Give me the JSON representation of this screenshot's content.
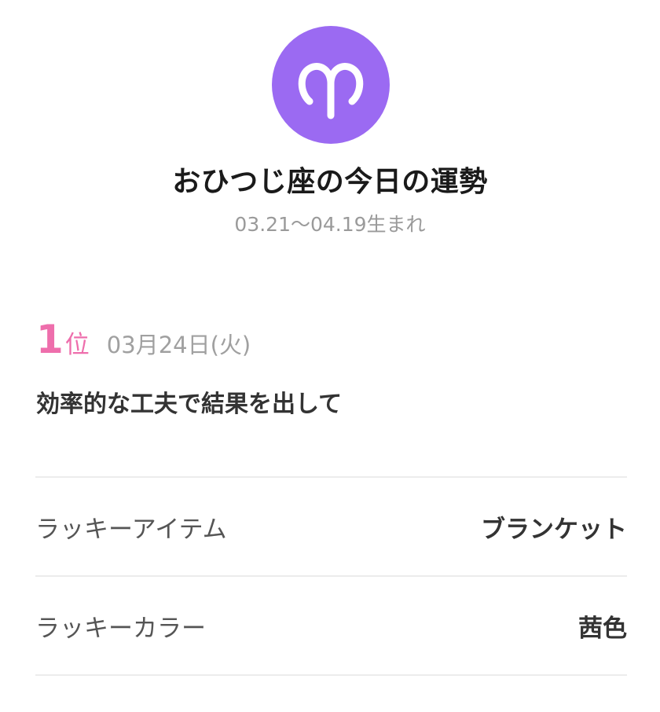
{
  "sign": {
    "icon": "aries-icon",
    "color": "#9b6af2",
    "title": "おひつじ座の今日の運勢",
    "birth_range": "03.21〜04.19生まれ"
  },
  "fortune": {
    "rank_number": "1",
    "rank_unit": "位",
    "date": "03月24日(火)",
    "message": "効率的な工夫で結果を出して",
    "accent_color": "#ee6eac"
  },
  "lucky": [
    {
      "label": "ラッキーアイテム",
      "value": "ブランケット"
    },
    {
      "label": "ラッキーカラー",
      "value": "茜色"
    }
  ]
}
